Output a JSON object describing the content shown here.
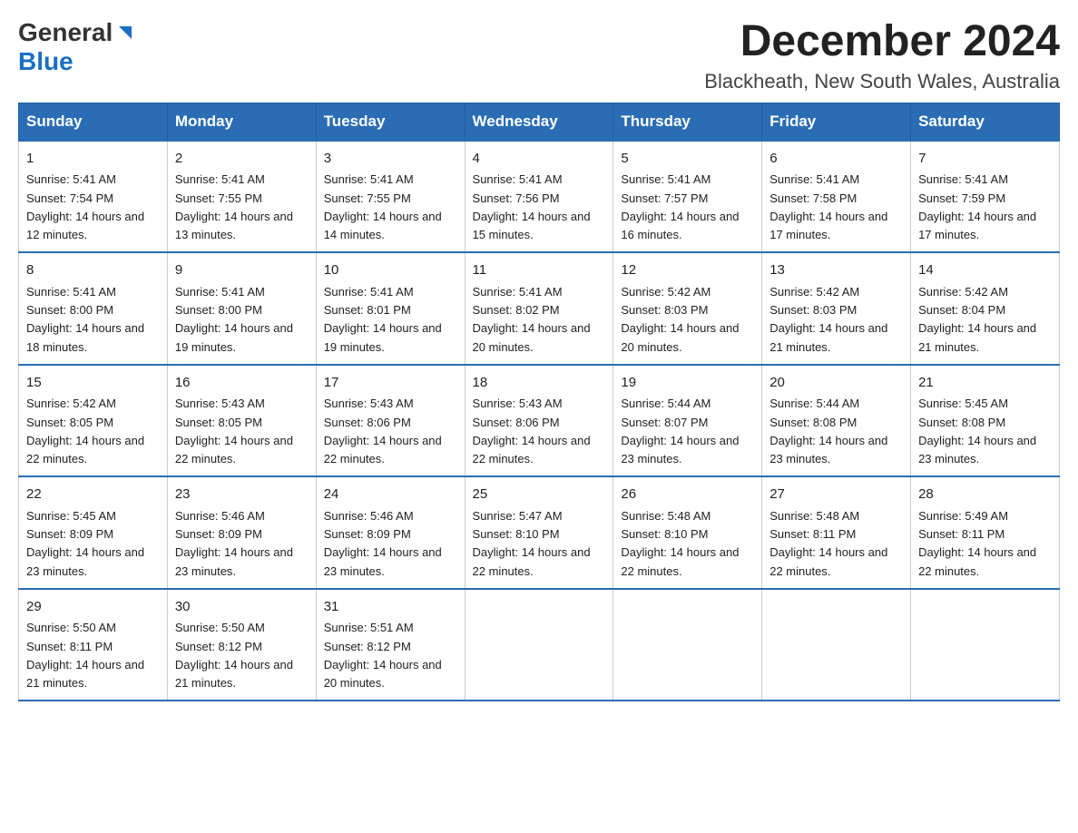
{
  "header": {
    "logo_general": "General",
    "logo_blue": "Blue",
    "month_title": "December 2024",
    "location": "Blackheath, New South Wales, Australia"
  },
  "days_of_week": [
    "Sunday",
    "Monday",
    "Tuesday",
    "Wednesday",
    "Thursday",
    "Friday",
    "Saturday"
  ],
  "weeks": [
    [
      {
        "day": "1",
        "sunrise": "Sunrise: 5:41 AM",
        "sunset": "Sunset: 7:54 PM",
        "daylight": "Daylight: 14 hours and 12 minutes."
      },
      {
        "day": "2",
        "sunrise": "Sunrise: 5:41 AM",
        "sunset": "Sunset: 7:55 PM",
        "daylight": "Daylight: 14 hours and 13 minutes."
      },
      {
        "day": "3",
        "sunrise": "Sunrise: 5:41 AM",
        "sunset": "Sunset: 7:55 PM",
        "daylight": "Daylight: 14 hours and 14 minutes."
      },
      {
        "day": "4",
        "sunrise": "Sunrise: 5:41 AM",
        "sunset": "Sunset: 7:56 PM",
        "daylight": "Daylight: 14 hours and 15 minutes."
      },
      {
        "day": "5",
        "sunrise": "Sunrise: 5:41 AM",
        "sunset": "Sunset: 7:57 PM",
        "daylight": "Daylight: 14 hours and 16 minutes."
      },
      {
        "day": "6",
        "sunrise": "Sunrise: 5:41 AM",
        "sunset": "Sunset: 7:58 PM",
        "daylight": "Daylight: 14 hours and 17 minutes."
      },
      {
        "day": "7",
        "sunrise": "Sunrise: 5:41 AM",
        "sunset": "Sunset: 7:59 PM",
        "daylight": "Daylight: 14 hours and 17 minutes."
      }
    ],
    [
      {
        "day": "8",
        "sunrise": "Sunrise: 5:41 AM",
        "sunset": "Sunset: 8:00 PM",
        "daylight": "Daylight: 14 hours and 18 minutes."
      },
      {
        "day": "9",
        "sunrise": "Sunrise: 5:41 AM",
        "sunset": "Sunset: 8:00 PM",
        "daylight": "Daylight: 14 hours and 19 minutes."
      },
      {
        "day": "10",
        "sunrise": "Sunrise: 5:41 AM",
        "sunset": "Sunset: 8:01 PM",
        "daylight": "Daylight: 14 hours and 19 minutes."
      },
      {
        "day": "11",
        "sunrise": "Sunrise: 5:41 AM",
        "sunset": "Sunset: 8:02 PM",
        "daylight": "Daylight: 14 hours and 20 minutes."
      },
      {
        "day": "12",
        "sunrise": "Sunrise: 5:42 AM",
        "sunset": "Sunset: 8:03 PM",
        "daylight": "Daylight: 14 hours and 20 minutes."
      },
      {
        "day": "13",
        "sunrise": "Sunrise: 5:42 AM",
        "sunset": "Sunset: 8:03 PM",
        "daylight": "Daylight: 14 hours and 21 minutes."
      },
      {
        "day": "14",
        "sunrise": "Sunrise: 5:42 AM",
        "sunset": "Sunset: 8:04 PM",
        "daylight": "Daylight: 14 hours and 21 minutes."
      }
    ],
    [
      {
        "day": "15",
        "sunrise": "Sunrise: 5:42 AM",
        "sunset": "Sunset: 8:05 PM",
        "daylight": "Daylight: 14 hours and 22 minutes."
      },
      {
        "day": "16",
        "sunrise": "Sunrise: 5:43 AM",
        "sunset": "Sunset: 8:05 PM",
        "daylight": "Daylight: 14 hours and 22 minutes."
      },
      {
        "day": "17",
        "sunrise": "Sunrise: 5:43 AM",
        "sunset": "Sunset: 8:06 PM",
        "daylight": "Daylight: 14 hours and 22 minutes."
      },
      {
        "day": "18",
        "sunrise": "Sunrise: 5:43 AM",
        "sunset": "Sunset: 8:06 PM",
        "daylight": "Daylight: 14 hours and 22 minutes."
      },
      {
        "day": "19",
        "sunrise": "Sunrise: 5:44 AM",
        "sunset": "Sunset: 8:07 PM",
        "daylight": "Daylight: 14 hours and 23 minutes."
      },
      {
        "day": "20",
        "sunrise": "Sunrise: 5:44 AM",
        "sunset": "Sunset: 8:08 PM",
        "daylight": "Daylight: 14 hours and 23 minutes."
      },
      {
        "day": "21",
        "sunrise": "Sunrise: 5:45 AM",
        "sunset": "Sunset: 8:08 PM",
        "daylight": "Daylight: 14 hours and 23 minutes."
      }
    ],
    [
      {
        "day": "22",
        "sunrise": "Sunrise: 5:45 AM",
        "sunset": "Sunset: 8:09 PM",
        "daylight": "Daylight: 14 hours and 23 minutes."
      },
      {
        "day": "23",
        "sunrise": "Sunrise: 5:46 AM",
        "sunset": "Sunset: 8:09 PM",
        "daylight": "Daylight: 14 hours and 23 minutes."
      },
      {
        "day": "24",
        "sunrise": "Sunrise: 5:46 AM",
        "sunset": "Sunset: 8:09 PM",
        "daylight": "Daylight: 14 hours and 23 minutes."
      },
      {
        "day": "25",
        "sunrise": "Sunrise: 5:47 AM",
        "sunset": "Sunset: 8:10 PM",
        "daylight": "Daylight: 14 hours and 22 minutes."
      },
      {
        "day": "26",
        "sunrise": "Sunrise: 5:48 AM",
        "sunset": "Sunset: 8:10 PM",
        "daylight": "Daylight: 14 hours and 22 minutes."
      },
      {
        "day": "27",
        "sunrise": "Sunrise: 5:48 AM",
        "sunset": "Sunset: 8:11 PM",
        "daylight": "Daylight: 14 hours and 22 minutes."
      },
      {
        "day": "28",
        "sunrise": "Sunrise: 5:49 AM",
        "sunset": "Sunset: 8:11 PM",
        "daylight": "Daylight: 14 hours and 22 minutes."
      }
    ],
    [
      {
        "day": "29",
        "sunrise": "Sunrise: 5:50 AM",
        "sunset": "Sunset: 8:11 PM",
        "daylight": "Daylight: 14 hours and 21 minutes."
      },
      {
        "day": "30",
        "sunrise": "Sunrise: 5:50 AM",
        "sunset": "Sunset: 8:12 PM",
        "daylight": "Daylight: 14 hours and 21 minutes."
      },
      {
        "day": "31",
        "sunrise": "Sunrise: 5:51 AM",
        "sunset": "Sunset: 8:12 PM",
        "daylight": "Daylight: 14 hours and 20 minutes."
      },
      null,
      null,
      null,
      null
    ]
  ]
}
